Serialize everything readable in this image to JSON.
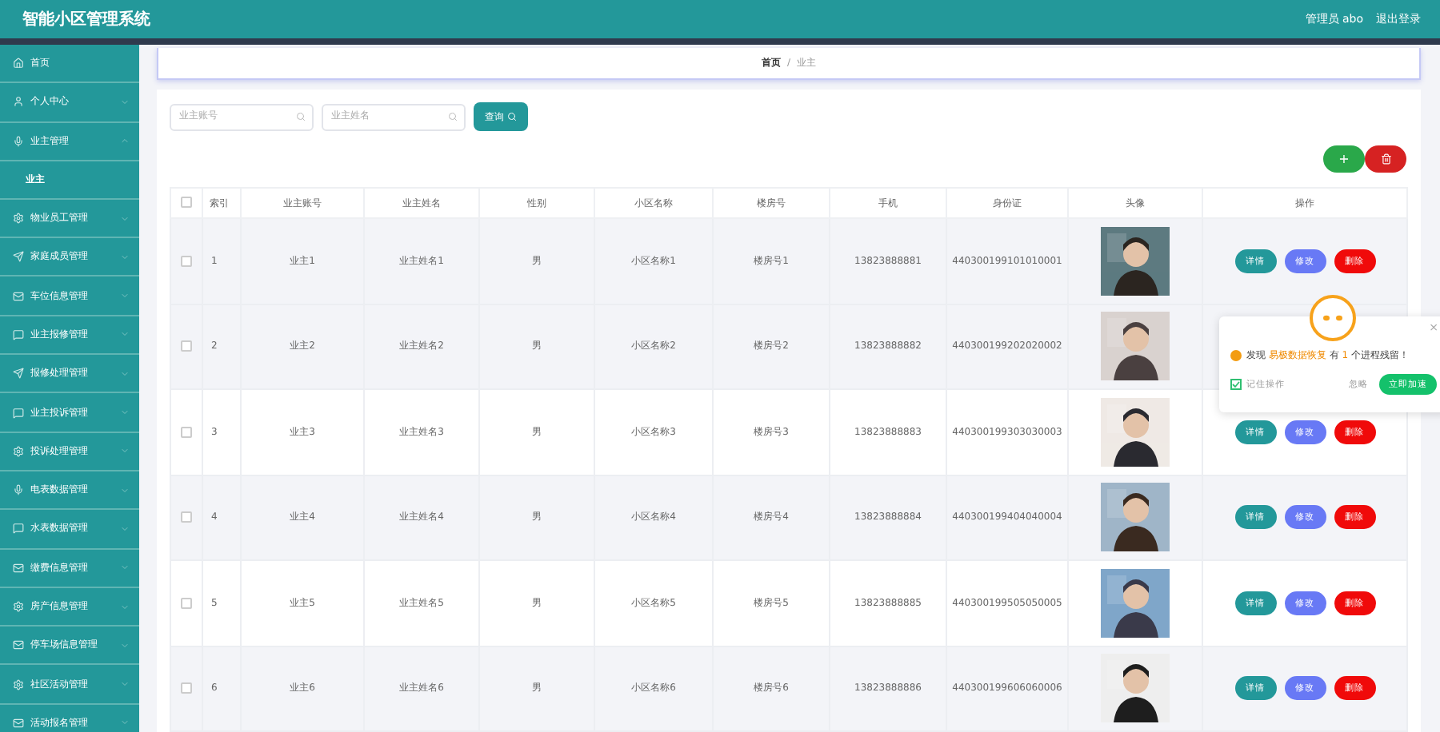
{
  "header": {
    "title": "智能小区管理系统",
    "user": "管理员 abo",
    "logout": "退出登录"
  },
  "sidebar": {
    "items": [
      {
        "label": "首页"
      },
      {
        "label": "个人中心",
        "expanded": false
      },
      {
        "label": "业主管理",
        "expanded": true,
        "children": [
          {
            "label": "业主"
          }
        ]
      },
      {
        "label": "物业员工管理",
        "expanded": false
      },
      {
        "label": "家庭成员管理",
        "expanded": false
      },
      {
        "label": "车位信息管理",
        "expanded": false
      },
      {
        "label": "业主报修管理",
        "expanded": false
      },
      {
        "label": "报修处理管理",
        "expanded": false
      },
      {
        "label": "业主投诉管理",
        "expanded": false
      },
      {
        "label": "投诉处理管理",
        "expanded": false
      },
      {
        "label": "电表数据管理",
        "expanded": false
      },
      {
        "label": "水表数据管理",
        "expanded": false
      },
      {
        "label": "缴费信息管理",
        "expanded": false
      },
      {
        "label": "房产信息管理",
        "expanded": false
      },
      {
        "label": "停车场信息管理",
        "expanded": false
      },
      {
        "label": "社区活动管理",
        "expanded": false
      },
      {
        "label": "活动报名管理",
        "expanded": false
      }
    ]
  },
  "breadcrumb": {
    "items": [
      "首页",
      "业主"
    ],
    "separator": "/"
  },
  "search": {
    "fields": [
      {
        "placeholder": "业主账号"
      },
      {
        "placeholder": "业主姓名"
      }
    ],
    "button": "查询"
  },
  "toolbar": {
    "add": "+"
  },
  "table": {
    "select_all_checked": false,
    "columns": [
      "索引",
      "业主账号",
      "业主姓名",
      "性别",
      "小区名称",
      "楼房号",
      "手机",
      "身份证",
      "头像",
      "操作"
    ],
    "rows": [
      {
        "highlighted": true,
        "checked": false,
        "cells": [
          "1",
          "业主1",
          "业主姓名1",
          "男",
          "小区名称1",
          "楼房号1",
          "13823888881",
          "440300199101010001"
        ],
        "actions": [
          "详情",
          "修改",
          "删除"
        ]
      },
      {
        "highlighted": true,
        "checked": false,
        "cells": [
          "2",
          "业主2",
          "业主姓名2",
          "男",
          "小区名称2",
          "楼房号2",
          "13823888882",
          "440300199202020002"
        ]
      },
      {
        "highlighted": false,
        "checked": false,
        "cells": [
          "3",
          "业主3",
          "业主姓名3",
          "男",
          "小区名称3",
          "楼房号3",
          "13823888883",
          "440300199303030003"
        ],
        "actions": [
          "详情",
          "修改",
          "删除"
        ]
      },
      {
        "highlighted": true,
        "checked": false,
        "cells": [
          "4",
          "业主4",
          "业主姓名4",
          "男",
          "小区名称4",
          "楼房号4",
          "13823888884",
          "440300199404040004"
        ],
        "actions": [
          "详情",
          "修改",
          "删除"
        ]
      },
      {
        "highlighted": false,
        "checked": false,
        "cells": [
          "5",
          "业主5",
          "业主姓名5",
          "男",
          "小区名称5",
          "楼房号5",
          "13823888885",
          "440300199505050005"
        ],
        "actions": [
          "详情",
          "修改",
          "删除"
        ]
      },
      {
        "highlighted": true,
        "checked": false,
        "cells": [
          "6",
          "业主6",
          "业主姓名6",
          "男",
          "小区名称6",
          "楼房号6",
          "13823888886",
          "440300199606060006"
        ],
        "actions": [
          "详情",
          "修改",
          "删除"
        ]
      }
    ]
  },
  "popup": {
    "message": [
      {
        "text": "发现 ",
        "highlight": false
      },
      {
        "text": "易极数据恢复",
        "highlight": true
      },
      {
        "text": " 有 ",
        "highlight": false
      },
      {
        "text": "1",
        "highlight": true
      },
      {
        "text": " 个进程残留！",
        "highlight": false
      }
    ],
    "remember": {
      "label": "记住操作",
      "checked": true
    },
    "ignore": "忽略",
    "accelerate": "立即加速",
    "close": "×"
  }
}
